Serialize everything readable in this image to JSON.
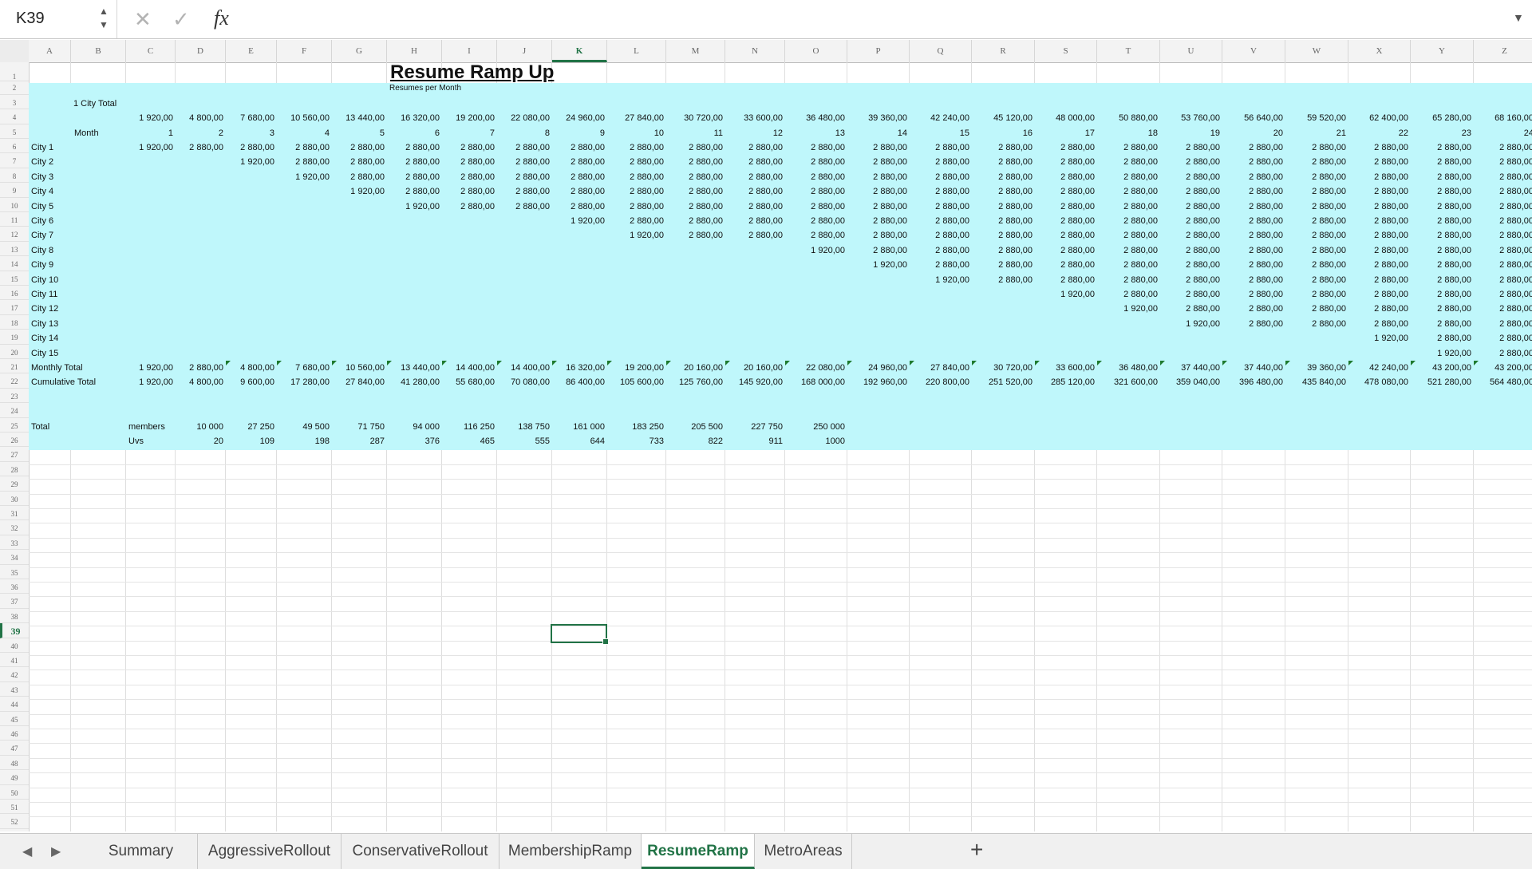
{
  "name_box": {
    "value": "K39"
  },
  "formula_bar": {
    "cancel": "✕",
    "enter": "✓",
    "fx": "fx",
    "value": ""
  },
  "columns": [
    "A",
    "B",
    "C",
    "D",
    "E",
    "F",
    "G",
    "H",
    "I",
    "J",
    "K",
    "L",
    "M",
    "N",
    "O",
    "P",
    "Q",
    "R",
    "S",
    "T",
    "U",
    "V",
    "W",
    "X",
    "Y",
    "Z"
  ],
  "active_column": "K",
  "active_row": 39,
  "row_count": 52,
  "sheet": {
    "title": "Resume Ramp Up",
    "subtitle": "Resumes per Month",
    "city_total_label": "1 City Total",
    "month_label": "Month",
    "monthly_total_label": "Monthly Total",
    "cumulative_total_label": "Cumulative Total",
    "total_label": "Total",
    "members_label": "members",
    "uvs_label": "Uvs",
    "city_totals": [
      "1 920,00",
      "4 800,00",
      "7 680,00",
      "10 560,00",
      "13 440,00",
      "16 320,00",
      "19 200,00",
      "22 080,00",
      "24 960,00",
      "27 840,00",
      "30 720,00",
      "33 600,00",
      "36 480,00",
      "39 360,00",
      "42 240,00",
      "45 120,00",
      "48 000,00",
      "50 880,00",
      "53 760,00",
      "56 640,00",
      "59 520,00",
      "62 400,00",
      "65 280,00",
      "68 160,00"
    ],
    "months": [
      "1",
      "2",
      "3",
      "4",
      "5",
      "6",
      "7",
      "8",
      "9",
      "10",
      "11",
      "12",
      "13",
      "14",
      "15",
      "16",
      "17",
      "18",
      "19",
      "20",
      "21",
      "22",
      "23",
      "24"
    ],
    "cities": [
      "City 1",
      "City 2",
      "City 3",
      "City 4",
      "City 5",
      "City 6",
      "City 7",
      "City 8",
      "City 9",
      "City 10",
      "City 11",
      "City 12",
      "City 13",
      "City 14",
      "City 15"
    ],
    "city_first_value": "1 920,00",
    "city_later_value": "2 880,00",
    "monthly_totals": [
      "1 920,00",
      "2 880,00",
      "4 800,00",
      "7 680,00",
      "10 560,00",
      "13 440,00",
      "14 400,00",
      "14 400,00",
      "16 320,00",
      "19 200,00",
      "20 160,00",
      "20 160,00",
      "22 080,00",
      "24 960,00",
      "27 840,00",
      "30 720,00",
      "33 600,00",
      "36 480,00",
      "37 440,00",
      "37 440,00",
      "39 360,00",
      "42 240,00",
      "43 200,00",
      "43 200,00"
    ],
    "cumulative_totals": [
      "1 920,00",
      "4 800,00",
      "9 600,00",
      "17 280,00",
      "27 840,00",
      "41 280,00",
      "55 680,00",
      "70 080,00",
      "86 400,00",
      "105 600,00",
      "125 760,00",
      "145 920,00",
      "168 000,00",
      "192 960,00",
      "220 800,00",
      "251 520,00",
      "285 120,00",
      "321 600,00",
      "359 040,00",
      "396 480,00",
      "435 840,00",
      "478 080,00",
      "521 280,00",
      "564 480,00"
    ],
    "members": [
      "10 000",
      "27 250",
      "49 500",
      "71 750",
      "94 000",
      "116 250",
      "138 750",
      "161 000",
      "183 250",
      "205 500",
      "227 750",
      "250 000"
    ],
    "uvs": [
      "20",
      "109",
      "198",
      "287",
      "376",
      "465",
      "555",
      "644",
      "733",
      "822",
      "911",
      "1000"
    ]
  },
  "sheet_tabs": [
    "Summary",
    "AggressiveRollout",
    "ConservativeRollout",
    "MembershipRamp",
    "ResumeRamp",
    "MetroAreas"
  ],
  "active_tab": "ResumeRamp",
  "add_sheet_label": "+",
  "colors": {
    "fill": "#bff7fb",
    "accent": "#217346"
  }
}
